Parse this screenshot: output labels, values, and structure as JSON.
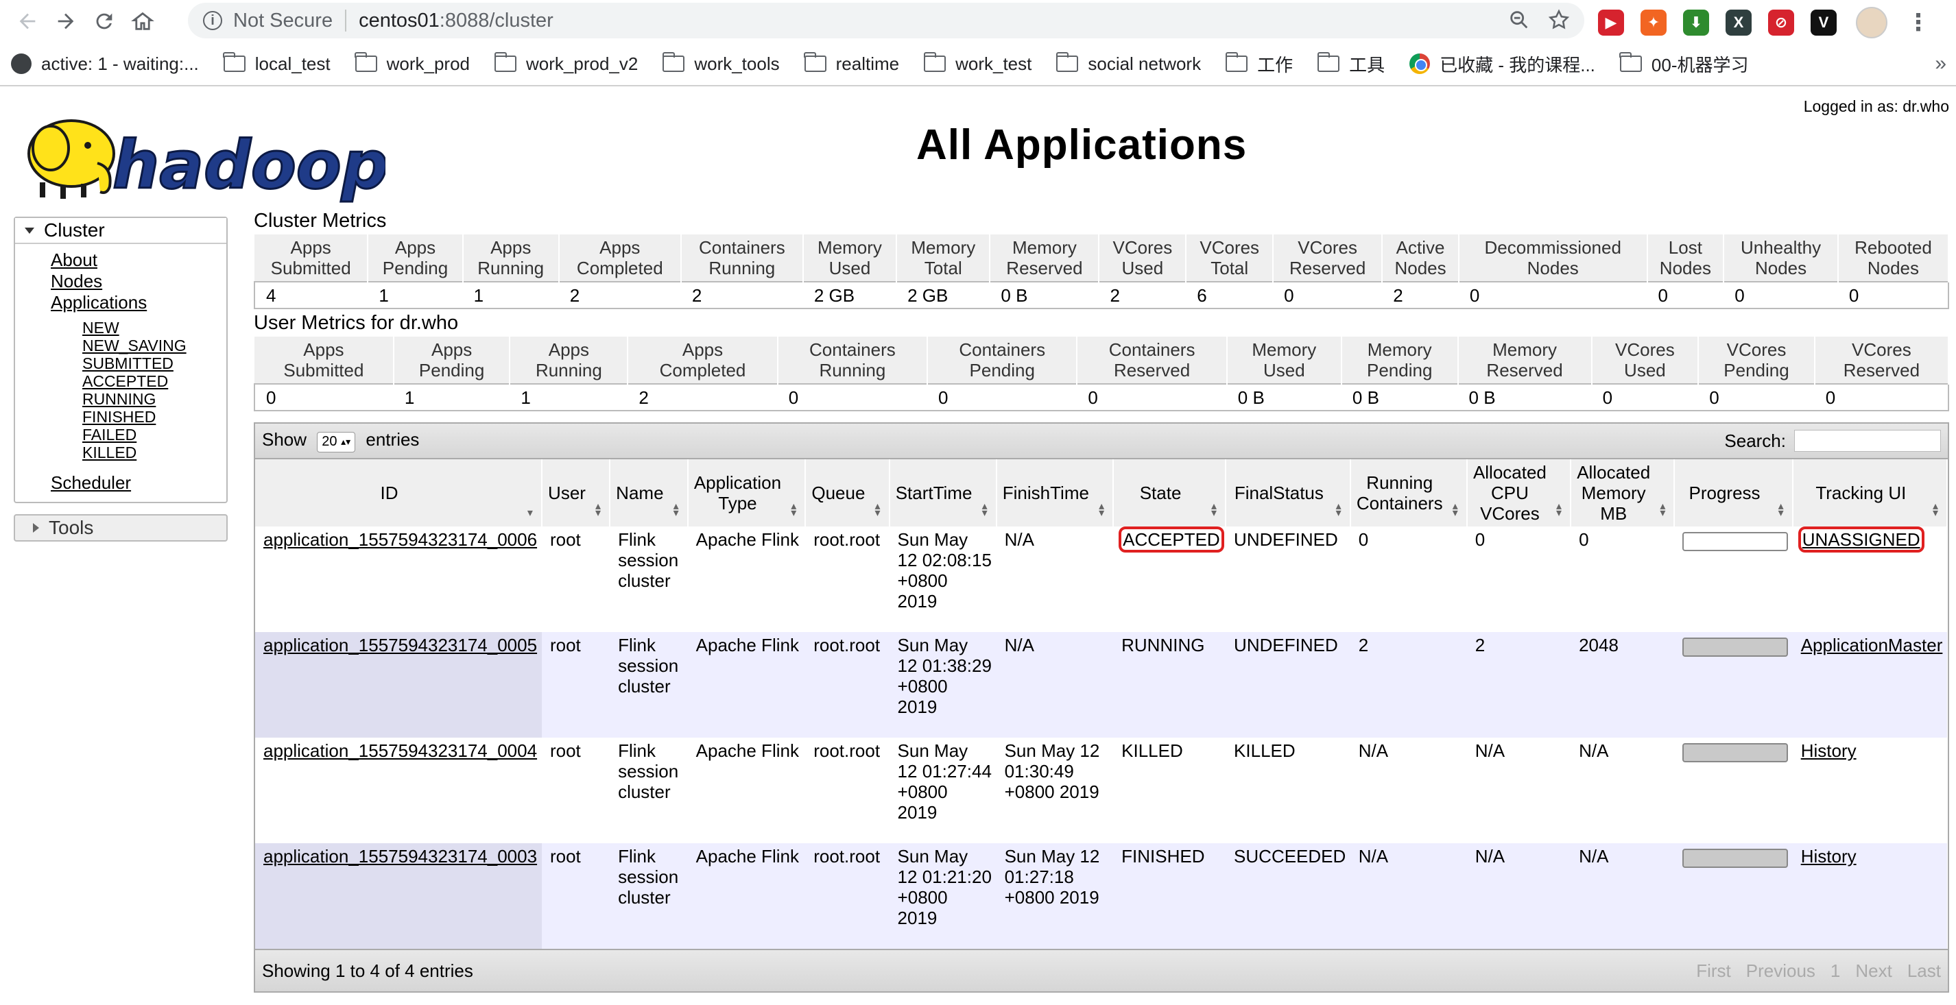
{
  "browser": {
    "url_security": "Not Secure",
    "url_host": "centos01",
    "url_path": ":8088/cluster",
    "bookmarks": [
      {
        "label": "active: 1 - waiting:...",
        "icon": "globe-icon"
      },
      {
        "label": "local_test",
        "icon": "folder-icon"
      },
      {
        "label": "work_prod",
        "icon": "folder-icon"
      },
      {
        "label": "work_prod_v2",
        "icon": "folder-icon"
      },
      {
        "label": "work_tools",
        "icon": "folder-icon"
      },
      {
        "label": "realtime",
        "icon": "folder-icon"
      },
      {
        "label": "work_test",
        "icon": "folder-icon"
      },
      {
        "label": "social network",
        "icon": "folder-icon"
      },
      {
        "label": "工作",
        "icon": "folder-icon"
      },
      {
        "label": "工具",
        "icon": "folder-icon"
      },
      {
        "label": "已收藏 - 我的课程...",
        "icon": "chrome-icon"
      },
      {
        "label": "00-机器学习",
        "icon": "folder-icon"
      }
    ],
    "bookmarks_more": "»",
    "extensions": [
      {
        "glyph": "▶",
        "color": "#d6232e"
      },
      {
        "glyph": "✦",
        "color": "#f26522"
      },
      {
        "glyph": "⬇",
        "color": "#2e8b2e"
      },
      {
        "glyph": "X",
        "color": "#2f3f3f"
      },
      {
        "glyph": "⊘",
        "color": "#d6232e"
      },
      {
        "glyph": "V",
        "color": "#111111"
      }
    ]
  },
  "header": {
    "logged_in": "Logged in as: dr.who",
    "logo_text": "hadoop",
    "title": "All Applications"
  },
  "sidebar": {
    "cluster_label": "Cluster",
    "links": [
      "About",
      "Nodes",
      "Applications"
    ],
    "states": [
      "NEW",
      "NEW_SAVING",
      "SUBMITTED",
      "ACCEPTED",
      "RUNNING",
      "FINISHED",
      "FAILED",
      "KILLED"
    ],
    "scheduler": "Scheduler",
    "tools_label": "Tools"
  },
  "cluster_metrics": {
    "title": "Cluster Metrics",
    "headers": [
      [
        "Apps",
        "Submitted"
      ],
      [
        "Apps",
        "Pending"
      ],
      [
        "Apps",
        "Running"
      ],
      [
        "Apps",
        "Completed"
      ],
      [
        "Containers",
        "Running"
      ],
      [
        "Memory",
        "Used"
      ],
      [
        "Memory",
        "Total"
      ],
      [
        "Memory",
        "Reserved"
      ],
      [
        "VCores",
        "Used"
      ],
      [
        "VCores",
        "Total"
      ],
      [
        "VCores",
        "Reserved"
      ],
      [
        "Active",
        "Nodes"
      ],
      [
        "Decommissioned",
        "Nodes"
      ],
      [
        "Lost",
        "Nodes"
      ],
      [
        "Unhealthy",
        "Nodes"
      ],
      [
        "Rebooted",
        "Nodes"
      ]
    ],
    "values": [
      "4",
      "1",
      "1",
      "2",
      "2",
      "2 GB",
      "2 GB",
      "0 B",
      "2",
      "6",
      "0",
      "2",
      "0",
      "0",
      "0",
      "0"
    ],
    "linked": [
      false,
      false,
      false,
      false,
      false,
      false,
      false,
      false,
      false,
      false,
      false,
      true,
      true,
      true,
      true,
      true
    ]
  },
  "user_metrics": {
    "title": "User Metrics for dr.who",
    "headers": [
      [
        "Apps",
        "Submitted"
      ],
      [
        "Apps",
        "Pending"
      ],
      [
        "Apps",
        "Running"
      ],
      [
        "Apps",
        "Completed"
      ],
      [
        "Containers",
        "Running"
      ],
      [
        "Containers",
        "Pending"
      ],
      [
        "Containers",
        "Reserved"
      ],
      [
        "Memory",
        "Used"
      ],
      [
        "Memory",
        "Pending"
      ],
      [
        "Memory",
        "Reserved"
      ],
      [
        "VCores",
        "Used"
      ],
      [
        "VCores",
        "Pending"
      ],
      [
        "VCores",
        "Reserved"
      ]
    ],
    "values": [
      "0",
      "1",
      "1",
      "2",
      "0",
      "0",
      "0",
      "0 B",
      "0 B",
      "0 B",
      "0",
      "0",
      "0"
    ]
  },
  "apps_table": {
    "show_label": "Show",
    "entries_value": "20",
    "entries_label": "entries",
    "search_label": "Search:",
    "headers": [
      "ID",
      "User",
      "Name",
      "Application Type",
      "Queue",
      "StartTime",
      "FinishTime",
      "State",
      "FinalStatus",
      "Running Containers",
      "Allocated CPU VCores",
      "Allocated Memory MB",
      "Progress",
      "Tracking UI"
    ],
    "rows": [
      {
        "id": "application_1557594323174_0006",
        "user": "root",
        "name": "Flink session cluster",
        "type": "Apache Flink",
        "queue": "root.root",
        "start": "Sun May 12 02:08:15 +0800 2019",
        "finish": "N/A",
        "state": "ACCEPTED",
        "final": "UNDEFINED",
        "containers": "0",
        "vcores": "0",
        "memory": "0",
        "progress": 0,
        "tracking": "UNASSIGNED"
      },
      {
        "id": "application_1557594323174_0005",
        "user": "root",
        "name": "Flink session cluster",
        "type": "Apache Flink",
        "queue": "root.root",
        "start": "Sun May 12 01:38:29 +0800 2019",
        "finish": "N/A",
        "state": "RUNNING",
        "final": "UNDEFINED",
        "containers": "2",
        "vcores": "2",
        "memory": "2048",
        "progress": 1,
        "tracking": "ApplicationMaster"
      },
      {
        "id": "application_1557594323174_0004",
        "user": "root",
        "name": "Flink session cluster",
        "type": "Apache Flink",
        "queue": "root.root",
        "start": "Sun May 12 01:27:44 +0800 2019",
        "finish": "Sun May 12 01:30:49 +0800 2019",
        "state": "KILLED",
        "final": "KILLED",
        "containers": "N/A",
        "vcores": "N/A",
        "memory": "N/A",
        "progress": 1,
        "tracking": "History"
      },
      {
        "id": "application_1557594323174_0003",
        "user": "root",
        "name": "Flink session cluster",
        "type": "Apache Flink",
        "queue": "root.root",
        "start": "Sun May 12 01:21:20 +0800 2019",
        "finish": "Sun May 12 01:27:18 +0800 2019",
        "state": "FINISHED",
        "final": "SUCCEEDED",
        "containers": "N/A",
        "vcores": "N/A",
        "memory": "N/A",
        "progress": 1,
        "tracking": "History"
      }
    ],
    "footer_info": "Showing 1 to 4 of 4 entries",
    "pager": [
      "First",
      "Previous",
      "1",
      "Next",
      "Last"
    ]
  }
}
